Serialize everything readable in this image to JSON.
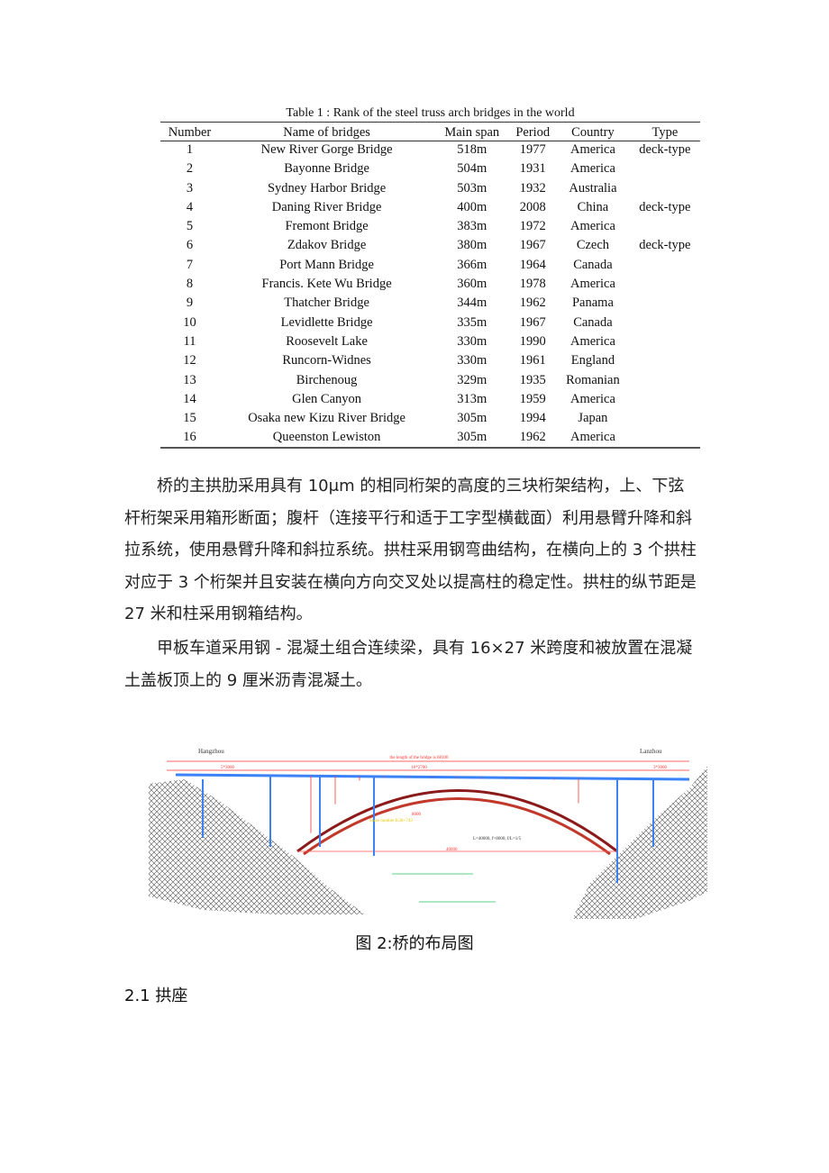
{
  "table": {
    "title": "Table 1 : Rank of the steel truss arch bridges in the world",
    "headers": [
      "Number",
      "Name of bridges",
      "Main span",
      "Period",
      "Country",
      "Type"
    ],
    "rows": [
      [
        "1",
        "New River Gorge Bridge",
        "518m",
        "1977",
        "America",
        "deck-type"
      ],
      [
        "2",
        "Bayonne Bridge",
        "504m",
        "1931",
        "America",
        ""
      ],
      [
        "3",
        "Sydney Harbor Bridge",
        "503m",
        "1932",
        "Australia",
        ""
      ],
      [
        "4",
        "Daning River Bridge",
        "400m",
        "2008",
        "China",
        "deck-type"
      ],
      [
        "5",
        "Fremont Bridge",
        "383m",
        "1972",
        "America",
        ""
      ],
      [
        "6",
        "Zdakov Bridge",
        "380m",
        "1967",
        "Czech",
        "deck-type"
      ],
      [
        "7",
        "Port Mann Bridge",
        "366m",
        "1964",
        "Canada",
        ""
      ],
      [
        "8",
        "Francis. Kete Wu Bridge",
        "360m",
        "1978",
        "America",
        ""
      ],
      [
        "9",
        "Thatcher Bridge",
        "344m",
        "1962",
        "Panama",
        ""
      ],
      [
        "10",
        "Levidlette Bridge",
        "335m",
        "1967",
        "Canada",
        ""
      ],
      [
        "11",
        "Roosevelt Lake",
        "330m",
        "1990",
        "America",
        ""
      ],
      [
        "12",
        "Runcorn-Widnes",
        "330m",
        "1961",
        "England",
        ""
      ],
      [
        "13",
        "Birchenoug",
        "329m",
        "1935",
        "Romanian",
        ""
      ],
      [
        "14",
        "Glen Canyon",
        "313m",
        "1959",
        "America",
        ""
      ],
      [
        "15",
        "Osaka new Kizu River Bridge",
        "305m",
        "1994",
        "Japan",
        ""
      ],
      [
        "16",
        "Queenston Lewiston",
        "305m",
        "1962",
        "America",
        ""
      ]
    ]
  },
  "paragraphs": [
    [
      "　　桥的主拱肋采用具有 10μm 的相同桁架的高度的三块桁架结构，上、下弦",
      "杆桁架采用箱形断面；腹杆（连接平行和适于工字型横截面）利用悬臂升降和斜",
      "拉系统，使用悬臂升降和斜拉系统。拱柱采用钢弯曲结构，在横向上的 3 个拱柱",
      "对应于 3 个桁架并且安装在横向方向交叉处以提高柱的稳定性。拱柱的纵节距是",
      "27 米和柱采用钢箱结构。"
    ],
    [
      "　　甲板车道采用钢 - 混凝土组合连续梁，具有 16×27 米跨度和被放置在混凝",
      "土盖板顶上的 9 厘米沥青混凝土。"
    ]
  ],
  "figure": {
    "left_label": "Hangzhou",
    "right_label": "Lanzhou",
    "length_label": "the length of the bridge is 68100",
    "span_label": "16*2700",
    "left_span": "5*3000",
    "right_span": "3*3000",
    "formula": "L=40000, f=8000, f/L=1/5",
    "rise": "8000",
    "chord": "40000",
    "stake": "Stake number K38+743",
    "colors": {
      "arch": "#c0392b",
      "deck": "#3b82f6",
      "rock": "#555555",
      "dim": "#ff3333",
      "note": "#e6c700"
    }
  },
  "caption": "图 2:桥的布局图",
  "heading": "2.1 拱座"
}
